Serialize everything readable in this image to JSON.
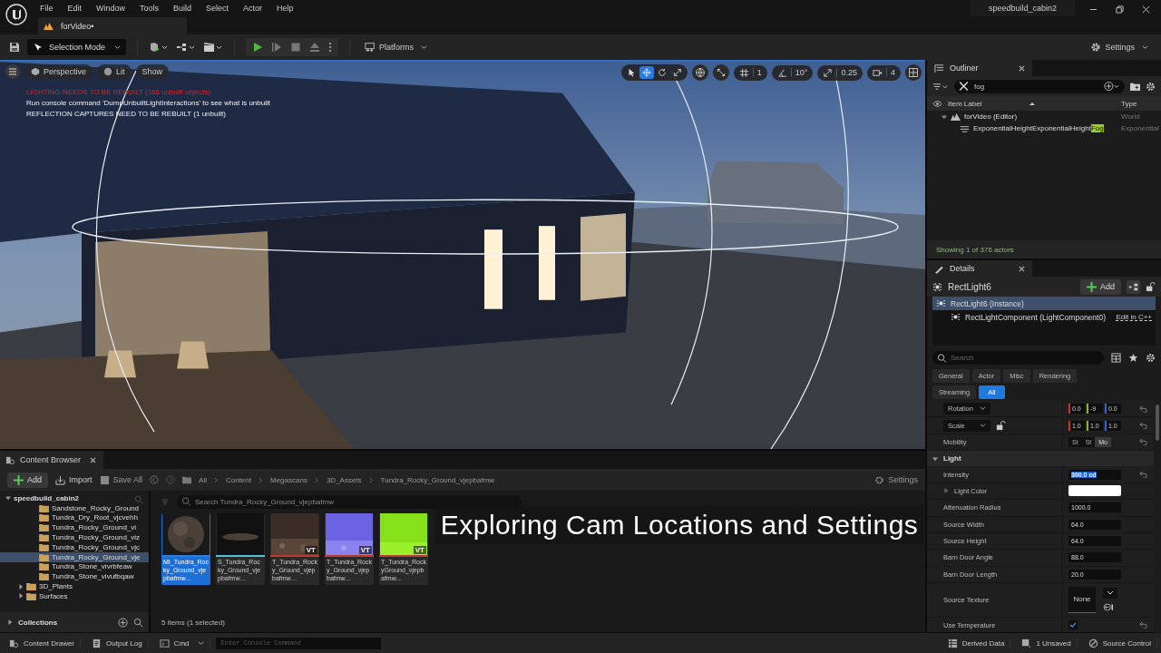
{
  "menu_bar": {
    "items": [
      "File",
      "Edit",
      "Window",
      "Tools",
      "Build",
      "Select",
      "Actor",
      "Help"
    ]
  },
  "project": {
    "name": "speedbuild_cabin2"
  },
  "level_tab": {
    "label": "forVideo•"
  },
  "toolbar": {
    "mode": "Selection Mode",
    "platforms": "Platforms",
    "settings": "Settings"
  },
  "viewport": {
    "view_buttons": [
      "Perspective",
      "Lit",
      "Show"
    ],
    "messages": [
      {
        "kind": "error",
        "text": "LIGHTING NEEDS TO BE REBUILT (166 unbuilt objects)"
      },
      {
        "kind": "info",
        "text": "Run console command 'DumpUnbuiltLightInteractions' to see what is unbuilt"
      },
      {
        "kind": "info",
        "text": "REFLECTION CAPTURES NEED TO BE REBUILT (1 unbuilt)"
      }
    ],
    "transform_tools": [
      {
        "kind": "select",
        "selected": false
      },
      {
        "kind": "move",
        "selected": true
      },
      {
        "kind": "rotate",
        "selected": false
      },
      {
        "kind": "scale",
        "selected": false
      }
    ],
    "grid_snap": "1",
    "angle_snap": "10°",
    "scale_snap": "0.25",
    "camera_speed": "4"
  },
  "outliner": {
    "title": "Outliner",
    "filter": "fog",
    "columns": [
      "Item Label",
      "Type"
    ],
    "rows": [
      {
        "label": "forVideo (Editor)",
        "type": "World",
        "expanded": true,
        "children": [
          {
            "label": "ExponentialHeightExponentialHeight",
            "match": "Fog",
            "type": "Exponential"
          }
        ]
      }
    ],
    "status": "Showing 1 of 376 actors"
  },
  "details": {
    "title": "Details",
    "actor": "RectLight6",
    "add": "Add",
    "components": [
      {
        "label": "RectLight6 (Instance)",
        "selected": true,
        "children": [
          {
            "label": "RectLightComponent (LightComponent0)",
            "selected": false
          }
        ]
      }
    ],
    "edit_link": "Edit in C++",
    "search_placeholder": "Search",
    "filters": [
      {
        "label": "General",
        "selected": false
      },
      {
        "label": "Actor",
        "selected": false
      },
      {
        "label": "Misc",
        "selected": false
      },
      {
        "label": "Rendering",
        "selected": false
      },
      {
        "label": "Streaming",
        "selected": false
      },
      {
        "label": "All",
        "selected": true
      }
    ],
    "properties": [
      {
        "kind": "vector",
        "label": "Rotation",
        "values": [
          "0.0",
          "-9",
          "0.0"
        ]
      },
      {
        "kind": "vector",
        "label": "Scale",
        "values": [
          "1.0",
          "1.0",
          "1.0"
        ]
      },
      {
        "kind": "segmented",
        "label": "Mobility",
        "options": [
          {
            "label": "St",
            "selected": false
          },
          {
            "label": "St",
            "selected": false
          },
          {
            "label": "Mo",
            "selected": true
          }
        ]
      },
      {
        "kind": "section",
        "label": "Light",
        "expanded": true
      },
      {
        "kind": "number",
        "label": "Intensity",
        "value": "300.0 cd",
        "selected": true
      },
      {
        "kind": "color",
        "label": "Light Color",
        "color": "#ffffff"
      },
      {
        "kind": "number",
        "label": "Attenuation Radius",
        "value": "1000.0",
        "selected": false
      },
      {
        "kind": "number",
        "label": "Source Width",
        "value": "64.0",
        "selected": false
      },
      {
        "kind": "number",
        "label": "Source Height",
        "value": "64.0",
        "selected": false
      },
      {
        "kind": "number",
        "label": "Barn Door Angle",
        "value": "88.0",
        "selected": false
      },
      {
        "kind": "number",
        "label": "Barn Door Length",
        "value": "20.0",
        "selected": false
      },
      {
        "kind": "asset",
        "label": "Source Texture",
        "value": "None"
      },
      {
        "kind": "checkbox",
        "label": "Use Temperature",
        "checked": true
      }
    ]
  },
  "content_browser": {
    "title": "Content Browser",
    "add": "Add",
    "import": "Import",
    "save_all": "Save All",
    "path": [
      "All",
      "Content",
      "Megascans",
      "3D_Assets",
      "Tundra_Rocky_Ground_vjepbafmw"
    ],
    "settings": "Settings",
    "tree": [
      {
        "label": "speedbuild_cabin2",
        "expanded": true,
        "selected": false,
        "children": [
          {
            "children": [
              {
                "label": "Sandstone_Rocky_Ground",
                "selected": false
              },
              {
                "label": "Tundra_Dry_Root_vjcvehh",
                "selected": false
              },
              {
                "label": "Tundra_Rocky_Ground_vi",
                "selected": false
              },
              {
                "label": "Tundra_Rocky_Ground_viz",
                "selected": false
              },
              {
                "label": "Tundra_Rocky_Ground_vjc",
                "selected": false
              },
              {
                "label": "Tundra_Rocky_Ground_vje",
                "selected": true
              },
              {
                "label": "Tundra_Stone_vivrbfeaw",
                "selected": false
              },
              {
                "label": "Tundra_Stone_vivufbqaw",
                "selected": false
              }
            ]
          },
          {
            "label": "3D_Plants",
            "expanded": false,
            "selected": false
          },
          {
            "label": "Surfaces",
            "expanded": false,
            "selected": false
          }
        ]
      }
    ],
    "collections": "Collections",
    "search_placeholder": "Search Tundra_Rocky_Ground_vjepbafmw",
    "assets": [
      {
        "name": "MI_Tundra_Rocky_Ground_vjepbafmw…",
        "kind": "sphere",
        "color": "#2f7fd6",
        "selected": true
      },
      {
        "name": "S_Tundra_Rocky_Ground_vjepbafmw…",
        "kind": "slab",
        "color": "#4fc6d8",
        "selected": false
      },
      {
        "name": "T_Tundra_Rocky_Ground_vjepbafmw…",
        "kind": "albedo",
        "color": "#c23a2f",
        "badge": "VT",
        "selected": false
      },
      {
        "name": "T_Tundra_Rocky_Ground_vjepbafmw…",
        "kind": "normal",
        "color": "#c23a2f",
        "badge": "VT",
        "selected": false
      },
      {
        "name": "T_Tundra_RockyGround_vjepbafmw…",
        "kind": "mask",
        "color": "#c23a2f",
        "badge": "VT",
        "selected": false
      }
    ],
    "count": "5 items (1 selected)"
  },
  "status_bar": {
    "left": [
      {
        "kind": "drawer",
        "label": "Content Drawer"
      },
      {
        "kind": "log",
        "label": "Output Log"
      },
      {
        "kind": "cmd",
        "label": "Cmd"
      }
    ],
    "console_placeholder": "Enter Console Command",
    "right": [
      {
        "kind": "ddc",
        "label": "Derived Data"
      },
      {
        "kind": "unsaved",
        "label": "1 Unsaved"
      },
      {
        "kind": "scm",
        "label": "Source Control"
      }
    ]
  },
  "caption": "Exploring Cam Locations and Settings"
}
